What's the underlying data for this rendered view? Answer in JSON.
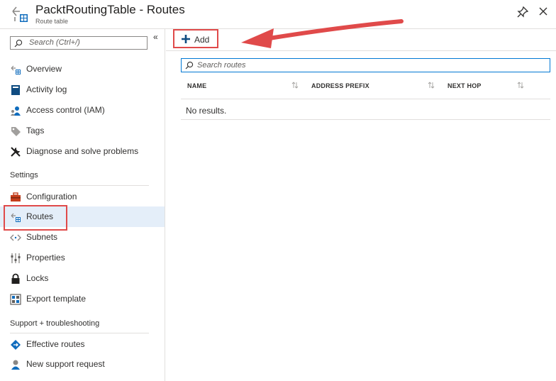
{
  "header": {
    "title": "PacktRoutingTable - Routes",
    "subtitle": "Route table",
    "icons": {
      "resource": "route-table-icon",
      "pin": "pin-icon",
      "close": "close-icon"
    }
  },
  "sidebar": {
    "collapse_glyph": "«",
    "search_placeholder": "Search (Ctrl+/)",
    "items_top": [
      {
        "label": "Overview",
        "icon": "route-table-icon"
      },
      {
        "label": "Activity log",
        "icon": "activity-log-icon"
      },
      {
        "label": "Access control (IAM)",
        "icon": "iam-icon"
      },
      {
        "label": "Tags",
        "icon": "tag-icon"
      },
      {
        "label": "Diagnose and solve problems",
        "icon": "wrench-icon"
      }
    ],
    "settings_heading": "Settings",
    "settings_items": [
      {
        "label": "Configuration",
        "icon": "toolbox-icon"
      },
      {
        "label": "Routes",
        "icon": "route-table-icon",
        "active": true
      },
      {
        "label": "Subnets",
        "icon": "subnet-icon"
      },
      {
        "label": "Properties",
        "icon": "properties-icon"
      },
      {
        "label": "Locks",
        "icon": "lock-icon"
      },
      {
        "label": "Export template",
        "icon": "export-template-icon"
      }
    ],
    "support_heading": "Support + troubleshooting",
    "support_items": [
      {
        "label": "Effective routes",
        "icon": "effective-routes-icon"
      },
      {
        "label": "New support request",
        "icon": "support-request-icon"
      }
    ]
  },
  "toolbar": {
    "add_label": "Add"
  },
  "main": {
    "search_placeholder": "Search routes",
    "columns": [
      "NAME",
      "ADDRESS PREFIX",
      "NEXT HOP"
    ],
    "empty_text": "No results."
  },
  "colors": {
    "accent": "#0078d4",
    "active_bg": "#e4eef9",
    "highlight": "#e04a4a"
  }
}
